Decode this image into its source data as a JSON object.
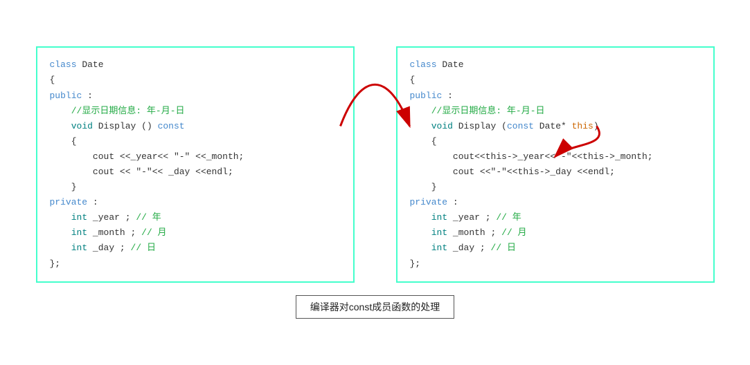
{
  "caption": "编译器对const成员函数的处理",
  "panel_left": {
    "lines": [
      {
        "type": "class_decl",
        "text": "class Date"
      },
      {
        "type": "brace",
        "text": "{"
      },
      {
        "type": "access",
        "keyword": "public",
        "text": "public :"
      },
      {
        "type": "comment",
        "text": "//显示日期信息: 年-月-日"
      },
      {
        "type": "func_decl",
        "text": "void Display () const"
      },
      {
        "type": "brace",
        "text": "{"
      },
      {
        "type": "code",
        "text": "cout <<_year<< \"-\" <<_month;"
      },
      {
        "type": "code",
        "text": "cout << \"-\"<< _day <<endl;"
      },
      {
        "type": "brace_close",
        "text": "}"
      },
      {
        "type": "access",
        "keyword": "private",
        "text": "private :"
      },
      {
        "type": "var",
        "text": "int _year ; // 年"
      },
      {
        "type": "var",
        "text": "int _month ; // 月"
      },
      {
        "type": "var",
        "text": "int _day ;   // 日"
      },
      {
        "type": "end",
        "text": "};"
      }
    ]
  },
  "panel_right": {
    "lines": [
      {
        "type": "class_decl",
        "text": "class Date"
      },
      {
        "type": "brace",
        "text": "{"
      },
      {
        "type": "access",
        "keyword": "public",
        "text": "public :"
      },
      {
        "type": "comment",
        "text": "//显示日期信息: 年-月-日"
      },
      {
        "type": "func_decl",
        "text": "void Display (const Date* this)"
      },
      {
        "type": "brace",
        "text": "{"
      },
      {
        "type": "code",
        "text": "cout<<this->_year<<\"-\"<<this->_month;"
      },
      {
        "type": "code",
        "text": "cout <<\"-\"<<this->_day <<endl;"
      },
      {
        "type": "brace_close",
        "text": "}"
      },
      {
        "type": "access",
        "keyword": "private",
        "text": "private :"
      },
      {
        "type": "var",
        "text": "int _year ; // 年"
      },
      {
        "type": "var",
        "text": "int _month ; // 月"
      },
      {
        "type": "var",
        "text": "int _day ;   // 日"
      },
      {
        "type": "end",
        "text": "};"
      }
    ]
  }
}
